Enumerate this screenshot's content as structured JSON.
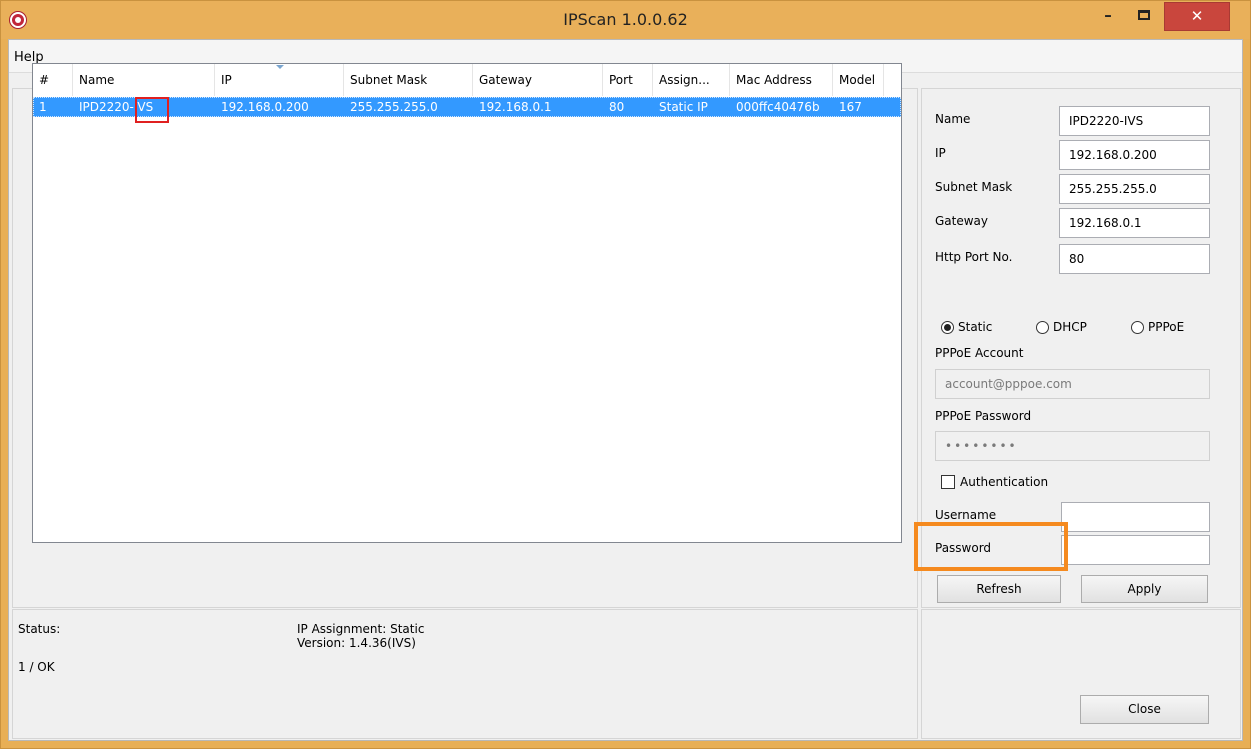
{
  "window": {
    "title": "IPScan 1.0.0.62",
    "controls": {
      "minimize": "–",
      "close": "✕"
    }
  },
  "menu": {
    "help": "Help"
  },
  "table": {
    "columns": [
      "#",
      "Name",
      "IP",
      "Subnet Mask",
      "Gateway",
      "Port",
      "Assign...",
      "Mac Address",
      "Model"
    ],
    "rows": [
      [
        "1",
        "IPD2220-IVS",
        "192.168.0.200",
        "255.255.255.0",
        "192.168.0.1",
        "80",
        "Static IP",
        "000ffc40476b",
        "167"
      ]
    ]
  },
  "status": {
    "label": "Status:",
    "count": "1 / OK",
    "assignment": "IP Assignment: Static",
    "version": "Version: 1.4.36(IVS)"
  },
  "details": {
    "name_label": "Name",
    "name_value": "IPD2220-IVS",
    "ip_label": "IP",
    "ip_value": "192.168.0.200",
    "subnet_label": "Subnet Mask",
    "subnet_value": "255.255.255.0",
    "gateway_label": "Gateway",
    "gateway_value": "192.168.0.1",
    "port_label": "Http Port No.",
    "port_value": "80",
    "mode_static": "Static",
    "mode_dhcp": "DHCP",
    "mode_pppoe": "PPPoE",
    "mode_selected": "Static",
    "pppoe_account_label": "PPPoE Account",
    "pppoe_account_value": "account@pppoe.com",
    "pppoe_password_label": "PPPoE Password",
    "pppoe_password_value": "••••••••",
    "auth_label": "Authentication",
    "auth_checked": false,
    "username_label": "Username",
    "username_value": "",
    "password_label": "Password",
    "password_value": ""
  },
  "buttons": {
    "refresh": "Refresh",
    "apply": "Apply",
    "close": "Close"
  },
  "colors": {
    "titlebar": "#e9b05a",
    "selection": "#3399ff",
    "highlight_name": "#e02020",
    "highlight_refresh": "#f58a1f",
    "close_button": "#c9463d"
  }
}
